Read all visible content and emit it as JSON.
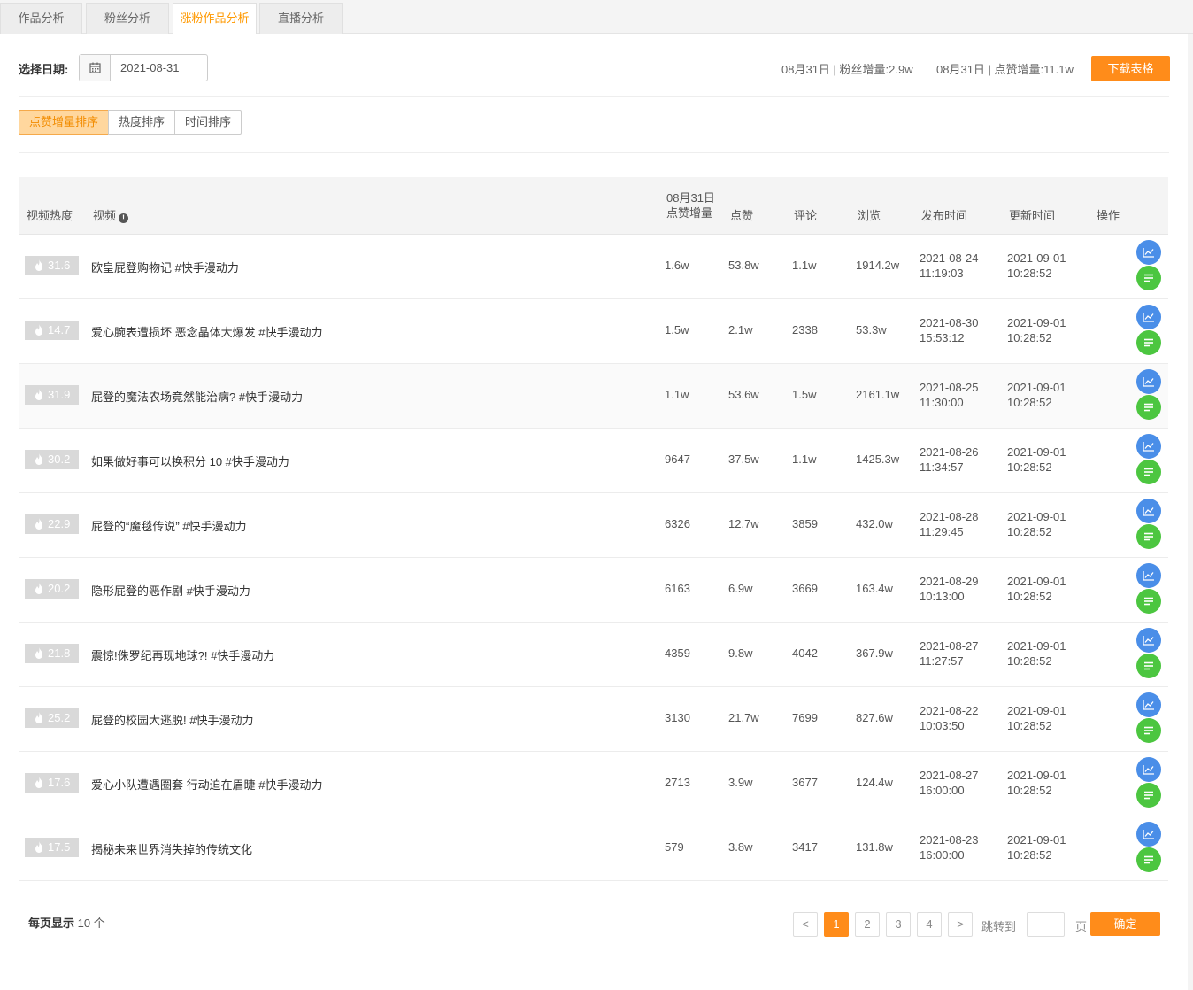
{
  "tabs": [
    {
      "label": "作品分析"
    },
    {
      "label": "粉丝分析"
    },
    {
      "label": "涨粉作品分析"
    },
    {
      "label": "直播分析"
    }
  ],
  "active_tab": "涨粉作品分析",
  "filter": {
    "date_label": "选择日期:",
    "date_value": "2021-08-31",
    "fans_summary": "08月31日 | 粉丝增量:2.9w",
    "likes_summary": "08月31日 | 点赞增量:11.1w",
    "download_label": "下载表格"
  },
  "sort": {
    "options": [
      "点赞增量排序",
      "热度排序",
      "时间排序"
    ],
    "active": "点赞增量排序"
  },
  "table": {
    "headers": {
      "heat": "视频热度",
      "video": "视频",
      "like_inc_line1": "08月31日",
      "like_inc_line2": "点赞增量",
      "likes": "点赞",
      "comments": "评论",
      "views": "浏览",
      "publish_time": "发布时间",
      "update_time": "更新时间",
      "actions": "操作"
    },
    "rows": [
      {
        "heat": "31.6",
        "title": "欧皇屁登购物记 #快手漫动力",
        "like_inc": "1.6w",
        "likes": "53.8w",
        "comments": "1.1w",
        "views": "1914.2w",
        "pub_date": "2021-08-24",
        "pub_time": "11:19:03",
        "upd_date": "2021-09-01",
        "upd_time": "10:28:52"
      },
      {
        "heat": "14.7",
        "title": "爱心腕表遭损坏 恶念晶体大爆发 #快手漫动力",
        "like_inc": "1.5w",
        "likes": "2.1w",
        "comments": "2338",
        "views": "53.3w",
        "pub_date": "2021-08-30",
        "pub_time": "15:53:12",
        "upd_date": "2021-09-01",
        "upd_time": "10:28:52"
      },
      {
        "heat": "31.9",
        "title": "屁登的魔法农场竟然能治病? #快手漫动力",
        "like_inc": "1.1w",
        "likes": "53.6w",
        "comments": "1.5w",
        "views": "2161.1w",
        "pub_date": "2021-08-25",
        "pub_time": "11:30:00",
        "upd_date": "2021-09-01",
        "upd_time": "10:28:52"
      },
      {
        "heat": "30.2",
        "title": "如果做好事可以换积分 10 #快手漫动力",
        "like_inc": "9647",
        "likes": "37.5w",
        "comments": "1.1w",
        "views": "1425.3w",
        "pub_date": "2021-08-26",
        "pub_time": "11:34:57",
        "upd_date": "2021-09-01",
        "upd_time": "10:28:52"
      },
      {
        "heat": "22.9",
        "title": "屁登的“魔毯传说” #快手漫动力",
        "like_inc": "6326",
        "likes": "12.7w",
        "comments": "3859",
        "views": "432.0w",
        "pub_date": "2021-08-28",
        "pub_time": "11:29:45",
        "upd_date": "2021-09-01",
        "upd_time": "10:28:52"
      },
      {
        "heat": "20.2",
        "title": "隐形屁登的恶作剧 #快手漫动力",
        "like_inc": "6163",
        "likes": "6.9w",
        "comments": "3669",
        "views": "163.4w",
        "pub_date": "2021-08-29",
        "pub_time": "10:13:00",
        "upd_date": "2021-09-01",
        "upd_time": "10:28:52"
      },
      {
        "heat": "21.8",
        "title": "震惊!侏罗纪再现地球?! #快手漫动力",
        "like_inc": "4359",
        "likes": "9.8w",
        "comments": "4042",
        "views": "367.9w",
        "pub_date": "2021-08-27",
        "pub_time": "11:27:57",
        "upd_date": "2021-09-01",
        "upd_time": "10:28:52"
      },
      {
        "heat": "25.2",
        "title": "屁登的校园大逃脱! #快手漫动力",
        "like_inc": "3130",
        "likes": "21.7w",
        "comments": "7699",
        "views": "827.6w",
        "pub_date": "2021-08-22",
        "pub_time": "10:03:50",
        "upd_date": "2021-09-01",
        "upd_time": "10:28:52"
      },
      {
        "heat": "17.6",
        "title": "爱心小队遭遇圈套 行动迫在眉睫 #快手漫动力",
        "like_inc": "2713",
        "likes": "3.9w",
        "comments": "3677",
        "views": "124.4w",
        "pub_date": "2021-08-27",
        "pub_time": "16:00:00",
        "upd_date": "2021-09-01",
        "upd_time": "10:28:52"
      },
      {
        "heat": "17.5",
        "title": "揭秘未来世界消失掉的传统文化",
        "like_inc": "579",
        "likes": "3.8w",
        "comments": "3417",
        "views": "131.8w",
        "pub_date": "2021-08-23",
        "pub_time": "16:00:00",
        "upd_date": "2021-09-01",
        "upd_time": "10:28:52"
      }
    ]
  },
  "pagination": {
    "page_size_label": "每页显示",
    "page_size_value": "10 个",
    "prev": "<",
    "next": ">",
    "pages": [
      "1",
      "2",
      "3",
      "4"
    ],
    "current": "1",
    "jump_label": "跳转到",
    "page_unit": "页",
    "confirm_label": "确定"
  },
  "colors": {
    "accent": "#ff8c1a",
    "trend_button": "#4a8ee8",
    "detail_button": "#4cc640",
    "heat_badge": "#d9d9d9"
  },
  "icons": {
    "calendar": "calendar-icon",
    "info": "info-icon",
    "flame": "flame-icon",
    "trend": "trend-chart-icon",
    "detail": "list-detail-icon"
  }
}
